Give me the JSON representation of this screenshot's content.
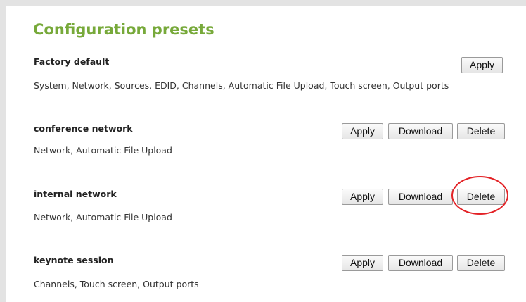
{
  "header": {
    "title": "Configuration presets"
  },
  "presets": [
    {
      "name": "Factory default",
      "description": "System, Network, Sources, EDID, Channels, Automatic File Upload, Touch screen, Output ports",
      "buttons": {
        "apply": "Apply"
      }
    },
    {
      "name": "conference network",
      "description": "Network, Automatic File Upload",
      "buttons": {
        "apply": "Apply",
        "download": "Download",
        "delete": "Delete"
      }
    },
    {
      "name": "internal network",
      "description": "Network, Automatic File Upload",
      "buttons": {
        "apply": "Apply",
        "download": "Download",
        "delete": "Delete"
      }
    },
    {
      "name": "keynote session",
      "description": "Channels, Touch screen, Output ports",
      "buttons": {
        "apply": "Apply",
        "download": "Download",
        "delete": "Delete"
      }
    }
  ],
  "annotation": {
    "highlight_color": "#e32226",
    "highlighted_button": "Delete"
  },
  "colors": {
    "title": "#77a93a"
  }
}
